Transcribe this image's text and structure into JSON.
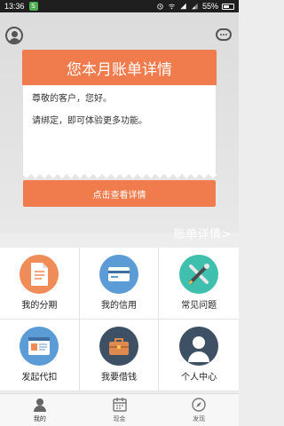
{
  "status_bar": {
    "time": "13:36",
    "notification": "S",
    "battery": "55%"
  },
  "header": {
    "avatar_icon": "user-circle-icon",
    "chat_icon": "chat-bubble-icon"
  },
  "bill_card": {
    "title": "您本月账单详情",
    "greeting": "尊敬的客户，您好。",
    "message": "请绑定，即可体验更多功能。"
  },
  "view_button": {
    "label": "点击查看详情"
  },
  "bill_detail_link": "账单详情>",
  "grid": [
    {
      "label": "我的分期",
      "icon": "document-icon"
    },
    {
      "label": "我的信用",
      "icon": "credit-card-icon"
    },
    {
      "label": "常见问题",
      "icon": "tools-icon"
    },
    {
      "label": "发起代扣",
      "icon": "browser-window-icon"
    },
    {
      "label": "我要借钱",
      "icon": "briefcase-icon"
    },
    {
      "label": "个人中心",
      "icon": "person-icon"
    }
  ],
  "tabbar": [
    {
      "label": "我的",
      "icon": "user-icon"
    },
    {
      "label": "现金",
      "icon": "calendar-icon"
    },
    {
      "label": "发现",
      "icon": "compass-icon"
    }
  ],
  "colors": {
    "accent": "#f07c4e",
    "blue": "#5b9cd6",
    "teal": "#3fbfae",
    "navy": "#3e5063"
  }
}
